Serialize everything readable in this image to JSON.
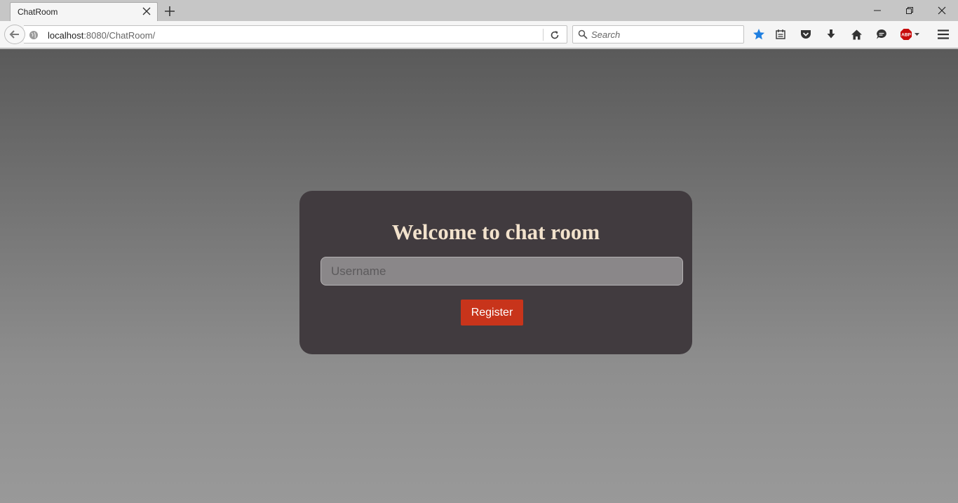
{
  "browser": {
    "tab": {
      "title": "ChatRoom"
    },
    "url": {
      "host": "localhost",
      "rest": ":8080/ChatRoom/"
    },
    "search": {
      "placeholder": "Search"
    },
    "toolbar_icons": [
      "bookmark-star-icon",
      "reading-list-icon",
      "pocket-icon",
      "download-icon",
      "home-icon",
      "chat-icon",
      "adblock-icon",
      "menu-icon"
    ],
    "adblock_label": "ABP"
  },
  "page": {
    "title": "Welcome to chat room",
    "username_placeholder": "Username",
    "register_label": "Register"
  },
  "colors": {
    "card_bg": "#413b3f",
    "title_color": "#f2e2cc",
    "register_bg": "#c8341b",
    "bookmark_star": "#1f7fe0",
    "adblock_red": "#c70d0d"
  }
}
